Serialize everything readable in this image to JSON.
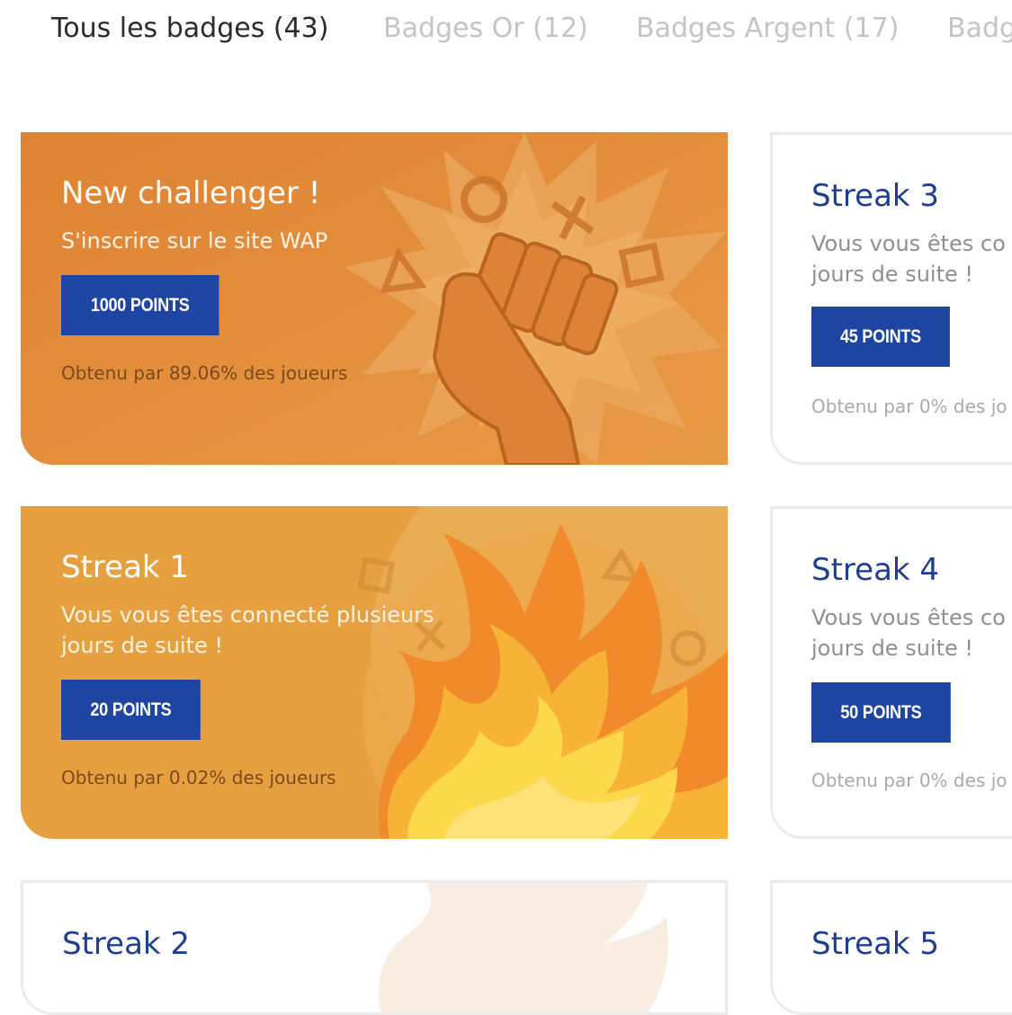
{
  "tabs": [
    {
      "label": "Tous les badges (43)",
      "active": true
    },
    {
      "label": "Badges Or (12)",
      "active": false
    },
    {
      "label": "Badges Argent (17)",
      "active": false
    },
    {
      "label": "Badg",
      "active": false
    }
  ],
  "badges": [
    {
      "title": "New challenger !",
      "description": "S'inscrire sur le site WAP",
      "points": "1000 POINTS",
      "obtained": "Obtenu par 89.06% des joueurs",
      "icon": "raised-fist-icon",
      "color": "#e3913c"
    },
    {
      "title": "Streak 3",
      "description": "Vous vous êtes co\njours de suite !",
      "points": "45 POINTS",
      "obtained": "Obtenu par 0% des jo"
    },
    {
      "title": "Streak 1",
      "description": "Vous vous êtes connecté plusieurs jours de suite !",
      "points": "20 POINTS",
      "obtained": "Obtenu par 0.02% des joueurs",
      "icon": "fire-icon",
      "color": "#e8a13e"
    },
    {
      "title": "Streak 4",
      "description": "Vous vous êtes co\njours de suite !",
      "points": "50 POINTS",
      "obtained": "Obtenu par 0% des jo"
    },
    {
      "title": "Streak 2"
    },
    {
      "title": "Streak 5"
    }
  ],
  "colors": {
    "button": "#1f45a3",
    "title_blue": "#1e3f8e",
    "tab_active": "#2b2b2b",
    "tab_inactive": "#c4c4c4"
  }
}
